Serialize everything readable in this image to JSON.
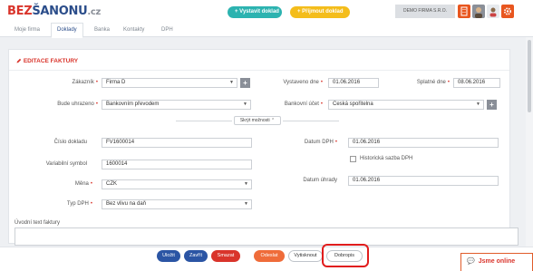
{
  "logo": {
    "part1": "BEZ",
    "part2": "ŠANONU",
    "part3": ".cz"
  },
  "topbar": {
    "issue_invoice": "+ Vystavit doklad",
    "receive_invoice": "+ Přijmout doklad",
    "company": "DEMO FIRMA S.R.O."
  },
  "tabs": [
    {
      "label": "Moje firma"
    },
    {
      "label": "Doklady"
    },
    {
      "label": "Banka"
    },
    {
      "label": "Kontakty"
    },
    {
      "label": "DPH"
    }
  ],
  "panel": {
    "title": "EDITACE FAKTURY"
  },
  "form": {
    "customer": {
      "label": "Zákazník",
      "value": "Firma D"
    },
    "payment_method": {
      "label": "Bude uhrazeno",
      "value": "Bankovním převodem"
    },
    "issued": {
      "label": "Vystaveno dne",
      "value": "01.06.2016"
    },
    "due": {
      "label": "Splatné dne",
      "value": "08.06.2016"
    },
    "bank_account": {
      "label": "Bankovní účet",
      "value": "Česká spořitelna"
    },
    "more_options": "Skrýt možnosti ⌃",
    "document_number": {
      "label": "Číslo dokladu",
      "value": "FV1600014"
    },
    "variable_symbol": {
      "label": "Variabilní symbol",
      "value": "1600014"
    },
    "currency": {
      "label": "Měna",
      "value": "CZK"
    },
    "vat_type": {
      "label": "Typ DPH",
      "value": "Bez vlivu na daň"
    },
    "vat_date": {
      "label": "Datum DPH",
      "value": "01.06.2016"
    },
    "historical_vat": {
      "label": "Historická sazba DPH"
    },
    "payment_date": {
      "label": "Datum úhrady",
      "value": "01.06.2016"
    },
    "intro_text": {
      "label": "Úvodní text faktury"
    }
  },
  "actions": {
    "save": "Uložit",
    "close": "Zavřít",
    "delete": "Smazat",
    "send": "Odeslat",
    "print": "Vytisknout",
    "credit_note": "Dobropis"
  },
  "chat": {
    "label": "Jsme online"
  },
  "colors": {
    "accent_red": "#d9342b",
    "brand_blue": "#2b4d8a",
    "teal": "#2cb3b0",
    "yellow": "#f4bd1b"
  }
}
